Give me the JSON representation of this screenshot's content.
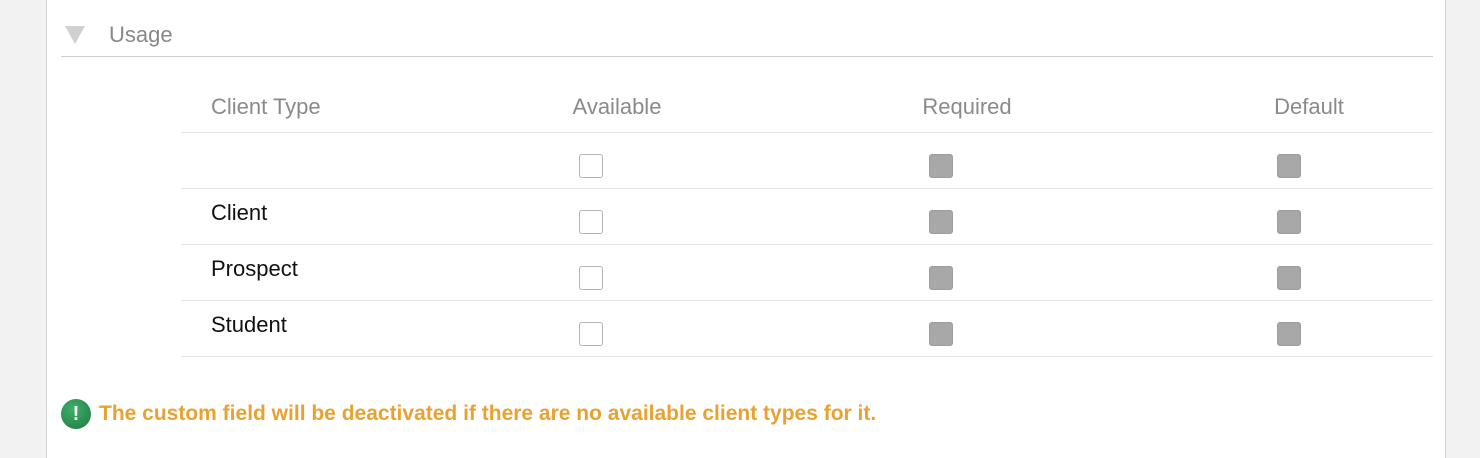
{
  "section": {
    "title": "Usage"
  },
  "table": {
    "headers": {
      "client_type": "Client Type",
      "available": "Available",
      "required": "Required",
      "default": "Default"
    },
    "rows": [
      {
        "label": "",
        "available": false,
        "required_disabled": true,
        "default_disabled": true
      },
      {
        "label": "Client",
        "available": false,
        "required_disabled": true,
        "default_disabled": true
      },
      {
        "label": "Prospect",
        "available": false,
        "required_disabled": true,
        "default_disabled": true
      },
      {
        "label": "Student",
        "available": false,
        "required_disabled": true,
        "default_disabled": true
      }
    ]
  },
  "notice": {
    "icon": "exclamation-circle-icon",
    "text": "The custom field will be deactivated if there are no available client types for it."
  },
  "colors": {
    "notice_text": "#e8a232",
    "notice_icon": "#2a8f50",
    "disabled_checkbox": "#a8a8a8"
  }
}
